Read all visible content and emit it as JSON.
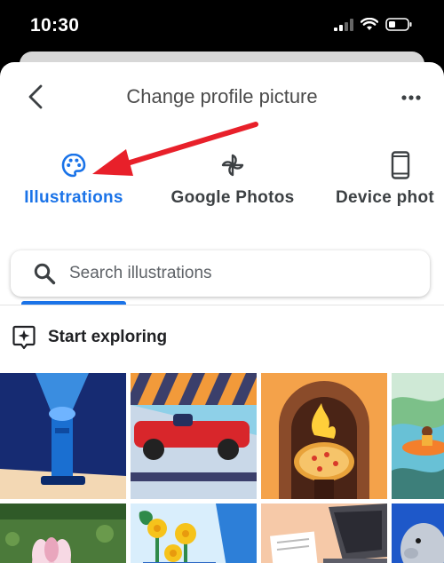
{
  "status_bar": {
    "time": "10:30"
  },
  "header": {
    "title": "Change profile picture"
  },
  "tabs": [
    {
      "label": "Illustrations",
      "active": true,
      "icon": "palette-icon"
    },
    {
      "label": "Google Photos",
      "active": false,
      "icon": "pinwheel-icon"
    },
    {
      "label": "Device phot",
      "active": false,
      "icon": "phone-icon"
    }
  ],
  "search": {
    "placeholder": "Search illustrations"
  },
  "section": {
    "label": "Start exploring",
    "icon": "sparkle-icon"
  },
  "tiles": [
    {
      "name": "flashlight-illustration"
    },
    {
      "name": "race-car-illustration"
    },
    {
      "name": "pizza-oven-illustration"
    },
    {
      "name": "river-raft-illustration"
    },
    {
      "name": "lotus-illustration"
    },
    {
      "name": "daffodils-illustration"
    },
    {
      "name": "laptop-desk-illustration"
    },
    {
      "name": "manatee-illustration"
    }
  ],
  "colors": {
    "accent": "#1a73e8",
    "arrow": "#e8202a"
  }
}
